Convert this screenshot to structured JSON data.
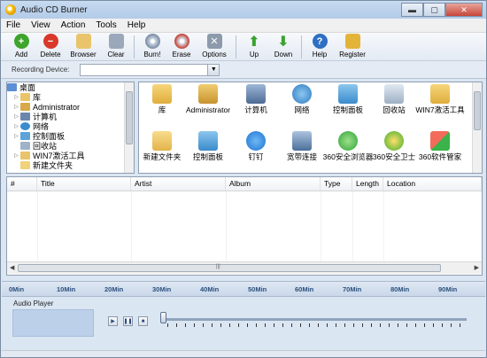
{
  "window": {
    "title": "Audio CD Burner"
  },
  "menu": [
    "File",
    "View",
    "Action",
    "Tools",
    "Help"
  ],
  "toolbar": {
    "add": "Add",
    "delete": "Delete",
    "browser": "Browser",
    "clear": "Clear",
    "burn": "Burn!",
    "erase": "Erase",
    "options": "Options",
    "up": "Up",
    "down": "Down",
    "help": "Help",
    "register": "Register"
  },
  "recording": {
    "label": "Recording Device:",
    "value": ""
  },
  "tree": [
    "桌面",
    "库",
    "Administrator",
    "计算机",
    "网络",
    "控制面板",
    "回收站",
    "WIN7激活工具",
    "新建文件夹"
  ],
  "icons": [
    "库",
    "Administrator",
    "计算机",
    "网络",
    "控制面板",
    "回收站",
    "WIN7激活工具",
    "新建文件夹",
    "控制面板",
    "钉钉",
    "宽带连接",
    "360安全浏览器",
    "360安全卫士",
    "360软件管家"
  ],
  "table": {
    "columns": [
      "#",
      "Title",
      "Artist",
      "Album",
      "Type",
      "Length",
      "Location"
    ]
  },
  "timeline": [
    "0Min",
    "10Min",
    "20Min",
    "30Min",
    "40Min",
    "50Min",
    "60Min",
    "70Min",
    "80Min",
    "90Min"
  ],
  "player": {
    "title": "Audio Player"
  },
  "colors": {
    "title_bg": "#c7daf0",
    "accent": "#2a4f7c",
    "panel": "#dbe6f3"
  }
}
